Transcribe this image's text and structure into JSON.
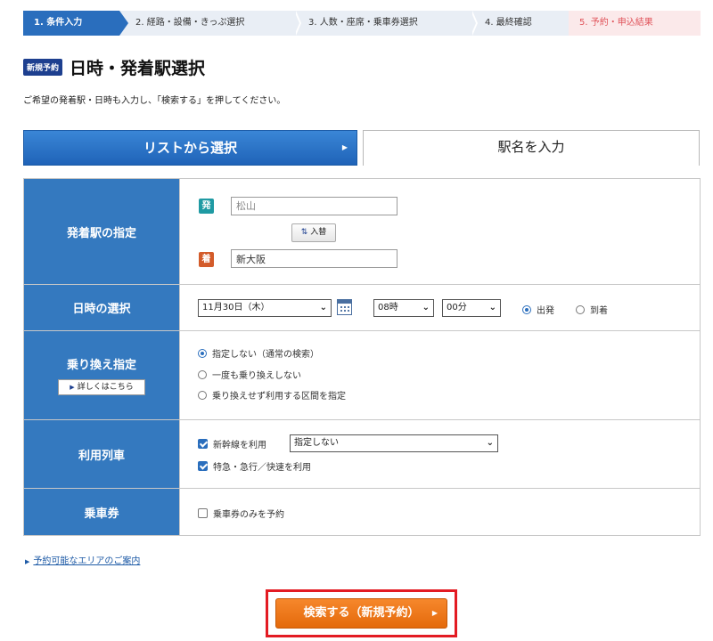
{
  "steps": [
    {
      "label": "1. 条件入力"
    },
    {
      "label": "2. 経路・設備・きっぷ選択"
    },
    {
      "label": "3. 人数・座席・乗車券選択"
    },
    {
      "label": "4. 最終確認"
    },
    {
      "label": "5. 予約・申込結果"
    }
  ],
  "header": {
    "badge": "新規予約",
    "title": "日時・発着駅選択",
    "instruction": "ご希望の発着駅・日時も入力し、「検索する」を押してください。"
  },
  "tabs": {
    "list_label": "リストから選択",
    "name_label": "駅名を入力"
  },
  "stations": {
    "label": "発着駅の指定",
    "from_tag": "発",
    "from_placeholder": "松山",
    "swap_label": "入替",
    "to_tag": "着",
    "to_value": "新大阪"
  },
  "datetime": {
    "label": "日時の選択",
    "date": "11月30日（木）",
    "hour": "08時",
    "minute": "00分",
    "depart_label": "出発",
    "arrive_label": "到着"
  },
  "transfer": {
    "label": "乗り換え指定",
    "detail_button": "詳しくはこちら",
    "options": [
      "指定しない（通常の検索）",
      "一度も乗り換えしない",
      "乗り換えせず利用する区間を指定"
    ]
  },
  "trains": {
    "label": "利用列車",
    "shinkansen_label": "新幹線を利用",
    "shinkansen_select": "指定しない",
    "express_label": "特急・急行／快速を利用"
  },
  "ticket": {
    "label": "乗車券",
    "only_label": "乗車券のみを予約"
  },
  "footer": {
    "area_link": "予約可能なエリアのご案内",
    "search_button": "検索する（新規予約）"
  }
}
